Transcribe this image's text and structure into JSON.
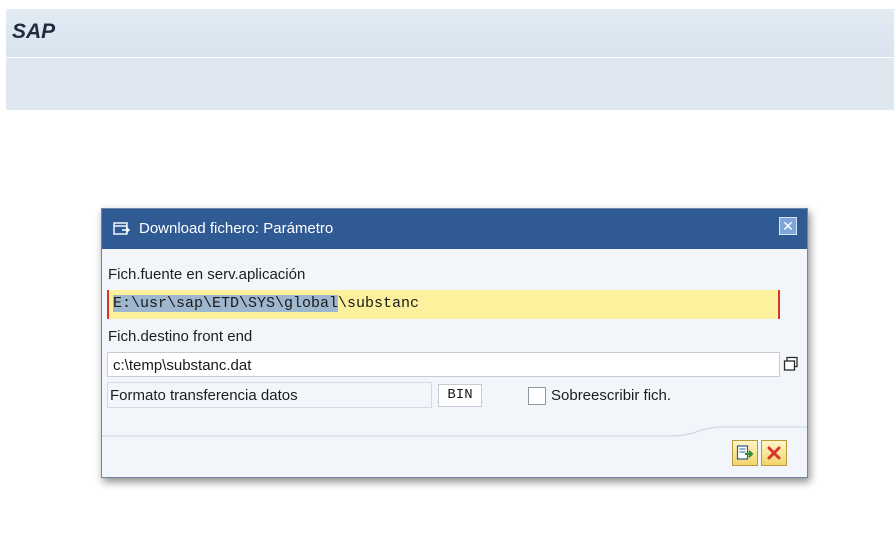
{
  "app": {
    "logo": "SAP"
  },
  "dialog": {
    "title": "Download fichero: Parámetro",
    "close_glyph": "✕",
    "source": {
      "label": "Fich.fuente en serv.aplicación",
      "value_selected": "E:\\usr\\sap\\ETD\\SYS\\global",
      "value_rest": "\\substanc"
    },
    "destination": {
      "label": "Fich.destino front end",
      "value": "c:\\temp\\substanc.dat"
    },
    "format": {
      "label": "Formato transferencia datos",
      "value": "BIN"
    },
    "overwrite": {
      "label": "Sobreescribir fich.",
      "checked": false
    },
    "buttons": {
      "execute_icon": "download-execute-icon",
      "cancel_icon": "cancel-x-icon"
    }
  },
  "colors": {
    "title_bar": "#2f5a94",
    "required_field": "#fdf19e",
    "selection": "#9fb6cf",
    "cancel_red": "#d9342b"
  }
}
